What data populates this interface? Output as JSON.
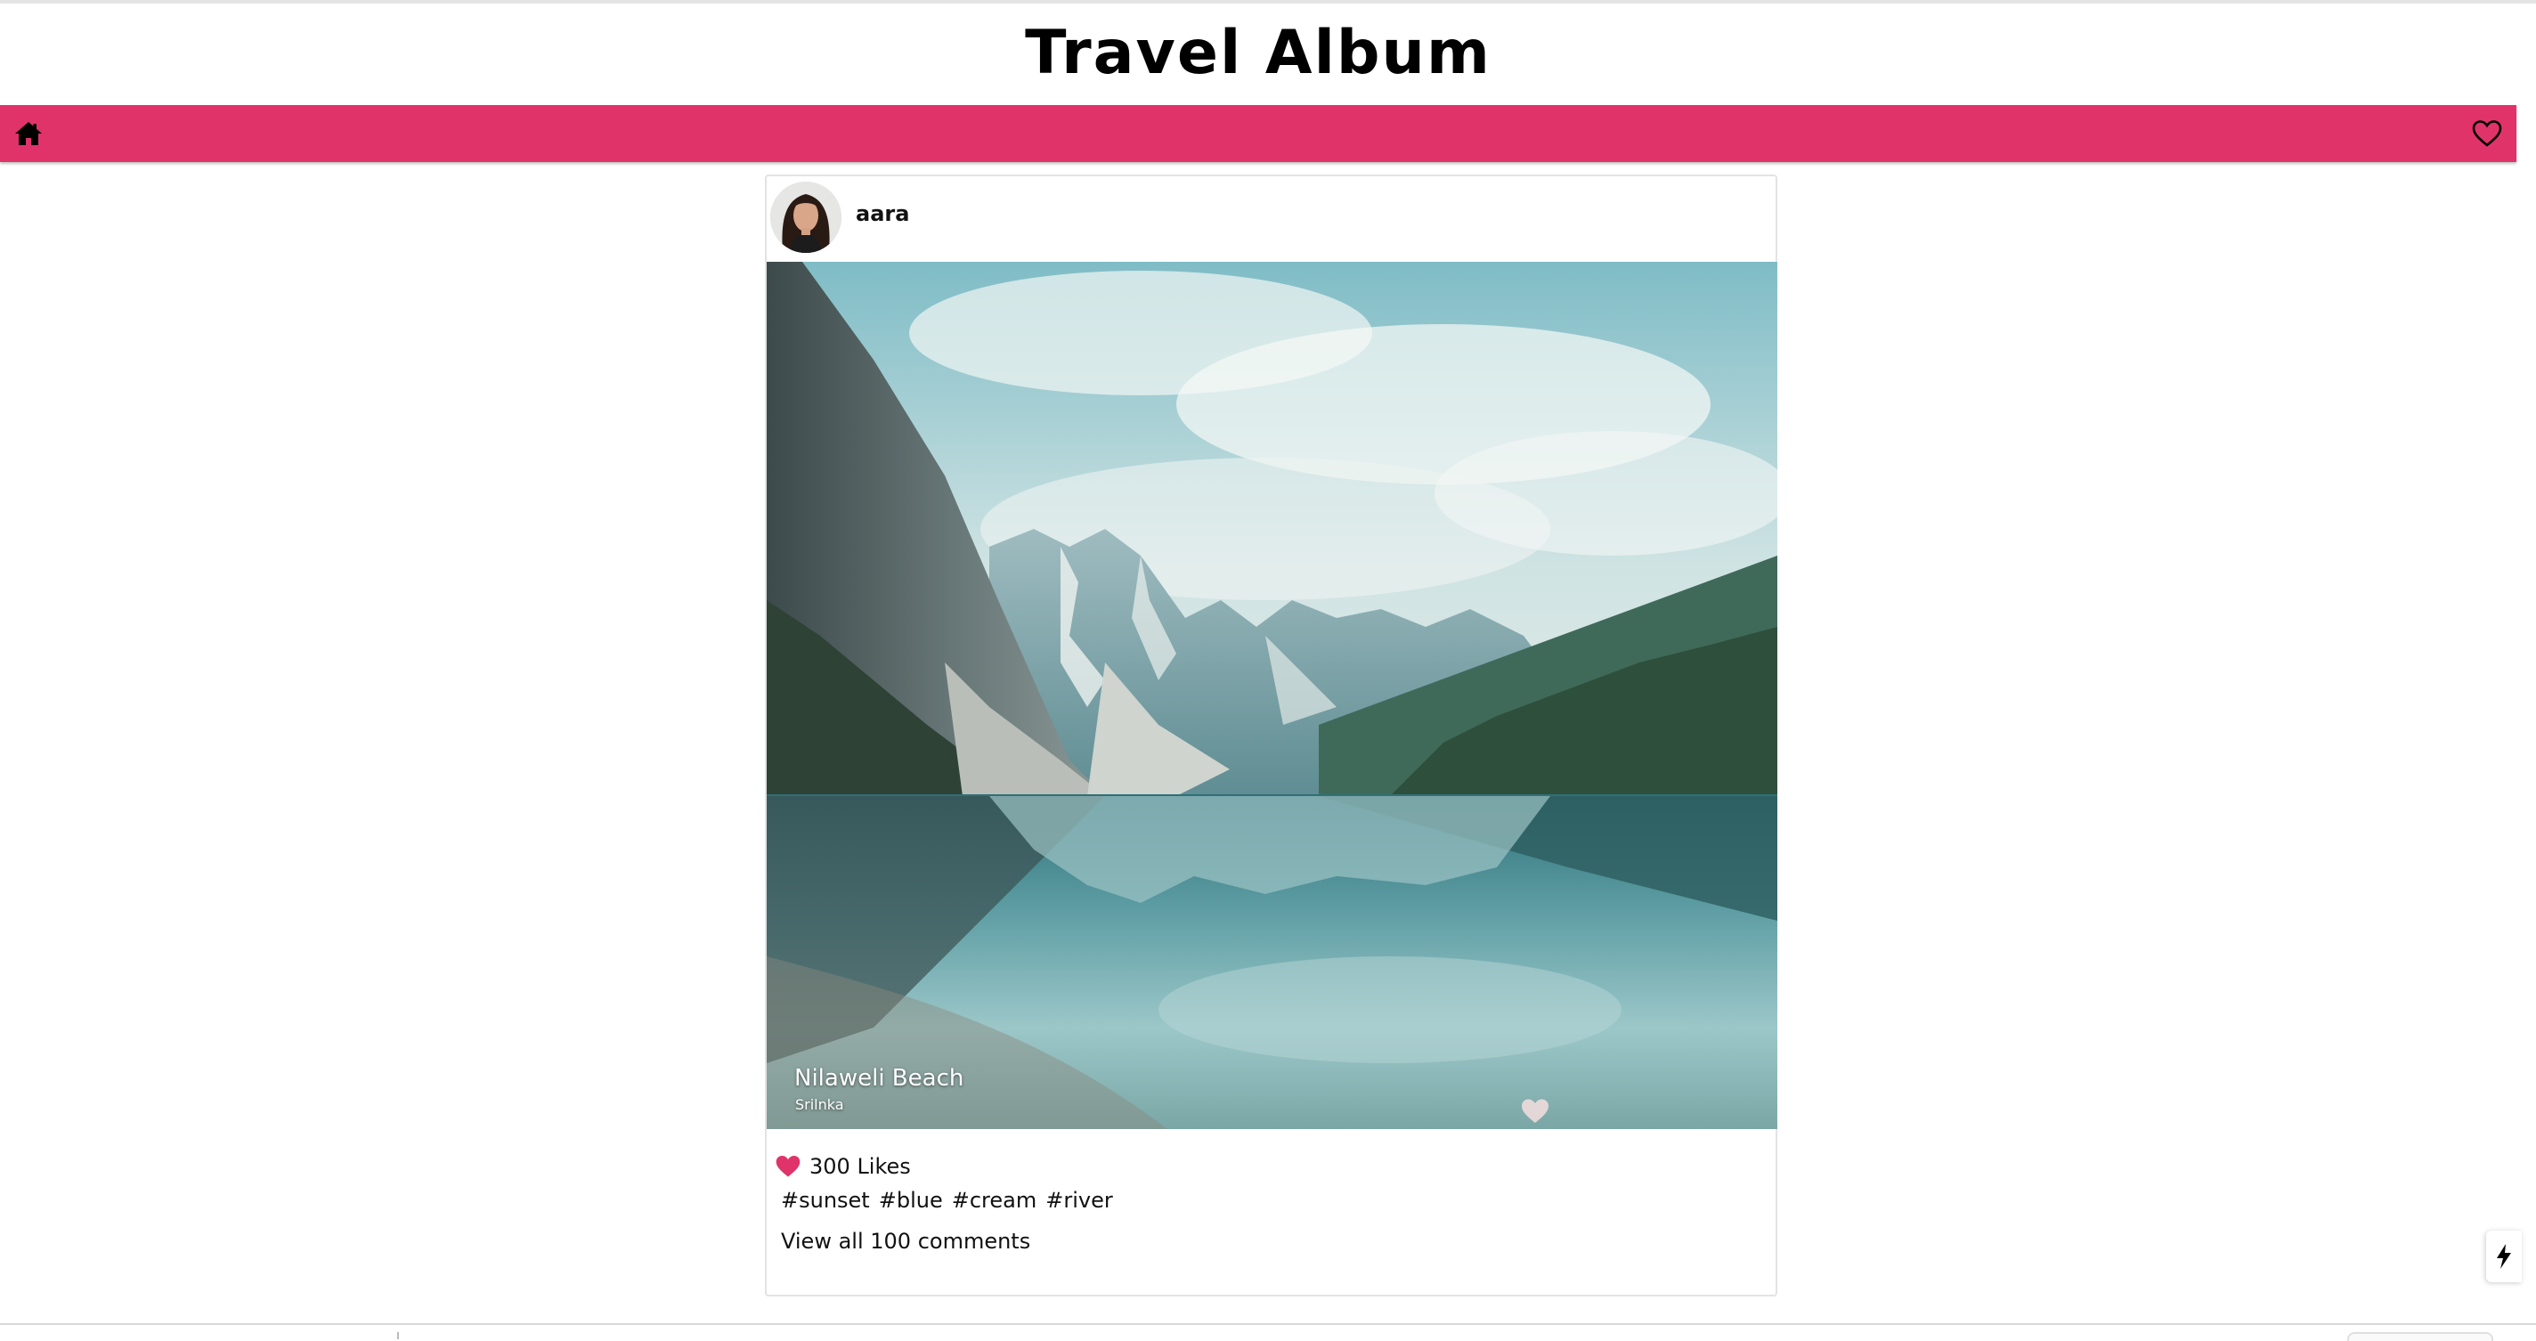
{
  "app": {
    "title": "Travel Album"
  },
  "navbar": {
    "color": "#e0336a",
    "home_icon": "home-icon",
    "favorites_icon": "heart-outline-icon"
  },
  "post": {
    "username": "aara",
    "image": {
      "location": "Nilaweli Beach",
      "sublocation": "Srilnka"
    },
    "likes_label": "300 Likes",
    "like_color": "#e0336a",
    "tags": [
      "#sunset",
      "#blue",
      "#cream",
      "#river"
    ],
    "comments_label": "View all 100 comments"
  },
  "floating": {
    "bolt_icon": "lightning-bolt-icon"
  }
}
